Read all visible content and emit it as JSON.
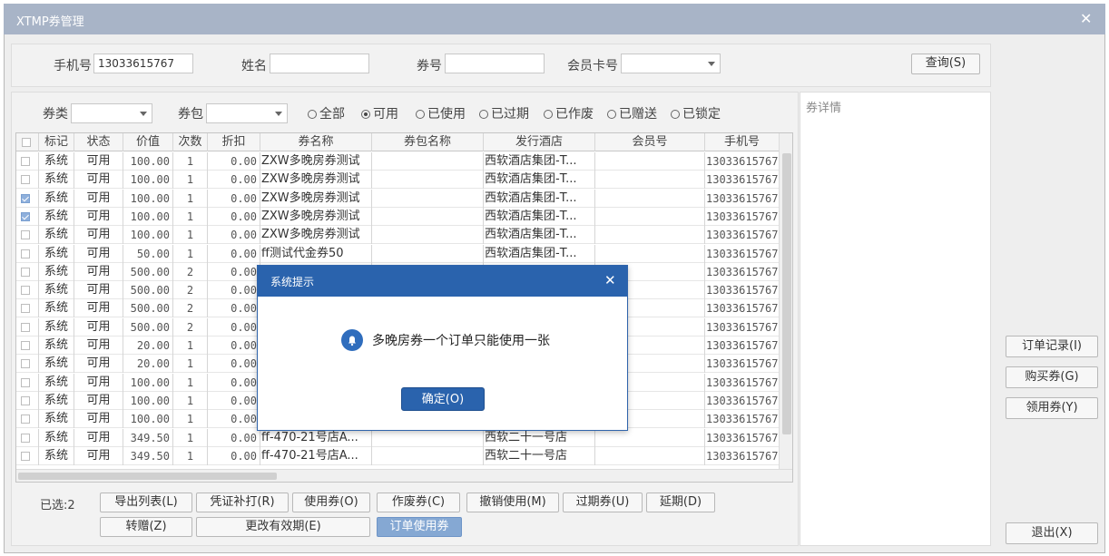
{
  "window": {
    "title": "XTMP券管理",
    "close": "✕"
  },
  "search": {
    "phone_label": "手机号",
    "phone_value": "13033615767",
    "name_label": "姓名",
    "name_value": "",
    "coupon_no_label": "券号",
    "coupon_no_value": "",
    "member_card_label": "会员卡号",
    "member_card_value": "",
    "query_button": "查询(S)"
  },
  "filters": {
    "type_label": "券类",
    "type_value": "",
    "package_label": "券包",
    "package_value": "",
    "status_options": [
      "全部",
      "可用",
      "已使用",
      "已过期",
      "已作废",
      "已赠送",
      "已锁定"
    ],
    "status_selected": "可用"
  },
  "grid": {
    "headers": [
      "",
      "标记",
      "状态",
      "价值",
      "次数",
      "折扣",
      "券名称",
      "券包名称",
      "发行酒店",
      "会员号",
      "手机号"
    ],
    "rows": [
      {
        "checked": false,
        "mark": "系统",
        "status": "可用",
        "value": "100.00",
        "count": "1",
        "discount": "0.00",
        "name": "ZXW多晚房券测试",
        "package": "",
        "hotel": "西软酒店集团-T...",
        "member": "",
        "phone": "13033615767"
      },
      {
        "checked": false,
        "mark": "系统",
        "status": "可用",
        "value": "100.00",
        "count": "1",
        "discount": "0.00",
        "name": "ZXW多晚房券测试",
        "package": "",
        "hotel": "西软酒店集团-T...",
        "member": "",
        "phone": "13033615767"
      },
      {
        "checked": true,
        "mark": "系统",
        "status": "可用",
        "value": "100.00",
        "count": "1",
        "discount": "0.00",
        "name": "ZXW多晚房券测试",
        "package": "",
        "hotel": "西软酒店集团-T...",
        "member": "",
        "phone": "13033615767"
      },
      {
        "checked": true,
        "mark": "系统",
        "status": "可用",
        "value": "100.00",
        "count": "1",
        "discount": "0.00",
        "name": "ZXW多晚房券测试",
        "package": "",
        "hotel": "西软酒店集团-T...",
        "member": "",
        "phone": "13033615767"
      },
      {
        "checked": false,
        "mark": "系统",
        "status": "可用",
        "value": "100.00",
        "count": "1",
        "discount": "0.00",
        "name": "ZXW多晚房券测试",
        "package": "",
        "hotel": "西软酒店集团-T...",
        "member": "",
        "phone": "13033615767"
      },
      {
        "checked": false,
        "mark": "系统",
        "status": "可用",
        "value": "50.00",
        "count": "1",
        "discount": "0.00",
        "name": "ff测试代金券50",
        "package": "",
        "hotel": "西软酒店集团-T...",
        "member": "",
        "phone": "13033615767"
      },
      {
        "checked": false,
        "mark": "系统",
        "status": "可用",
        "value": "500.00",
        "count": "2",
        "discount": "0.00",
        "name": "",
        "package": "",
        "hotel": "",
        "member": "",
        "phone": "13033615767"
      },
      {
        "checked": false,
        "mark": "系统",
        "status": "可用",
        "value": "500.00",
        "count": "2",
        "discount": "0.00",
        "name": "",
        "package": "",
        "hotel": "",
        "member": "",
        "phone": "13033615767"
      },
      {
        "checked": false,
        "mark": "系统",
        "status": "可用",
        "value": "500.00",
        "count": "2",
        "discount": "0.00",
        "name": "",
        "package": "",
        "hotel": "",
        "member": "",
        "phone": "13033615767"
      },
      {
        "checked": false,
        "mark": "系统",
        "status": "可用",
        "value": "500.00",
        "count": "2",
        "discount": "0.00",
        "name": "",
        "package": "",
        "hotel": "",
        "member": "",
        "phone": "13033615767"
      },
      {
        "checked": false,
        "mark": "系统",
        "status": "可用",
        "value": "20.00",
        "count": "1",
        "discount": "0.00",
        "name": "",
        "package": "",
        "hotel": "",
        "member": "",
        "phone": "13033615767"
      },
      {
        "checked": false,
        "mark": "系统",
        "status": "可用",
        "value": "20.00",
        "count": "1",
        "discount": "0.00",
        "name": "",
        "package": "",
        "hotel": "",
        "member": "",
        "phone": "13033615767"
      },
      {
        "checked": false,
        "mark": "系统",
        "status": "可用",
        "value": "100.00",
        "count": "1",
        "discount": "0.00",
        "name": "",
        "package": "",
        "hotel": "",
        "member": "",
        "phone": "13033615767"
      },
      {
        "checked": false,
        "mark": "系统",
        "status": "可用",
        "value": "100.00",
        "count": "1",
        "discount": "0.00",
        "name": "",
        "package": "",
        "hotel": "",
        "member": "",
        "phone": "13033615767"
      },
      {
        "checked": false,
        "mark": "系统",
        "status": "可用",
        "value": "100.00",
        "count": "1",
        "discount": "0.00",
        "name": "",
        "package": "",
        "hotel": "",
        "member": "",
        "phone": "13033615767"
      },
      {
        "checked": false,
        "mark": "系统",
        "status": "可用",
        "value": "349.50",
        "count": "1",
        "discount": "0.00",
        "name": "ff-470-21号店A...",
        "package": "",
        "hotel": "西软二十一号店",
        "member": "",
        "phone": "13033615767"
      },
      {
        "checked": false,
        "mark": "系统",
        "status": "可用",
        "value": "349.50",
        "count": "1",
        "discount": "0.00",
        "name": "ff-470-21号店A...",
        "package": "",
        "hotel": "西软二十一号店",
        "member": "",
        "phone": "13033615767"
      }
    ]
  },
  "detail": {
    "title": "券详情"
  },
  "side_buttons": {
    "order_record": "订单记录(I)",
    "buy_coupon": "购买券(G)",
    "use_coupon": "领用券(Y)",
    "exit": "退出(X)"
  },
  "bottom": {
    "selected_label": "已选:2",
    "row1": [
      "导出列表(L)",
      "凭证补打(R)",
      "使用券(O)",
      "作废券(C)",
      "撤销使用(M)",
      "过期券(U)",
      "延期(D)"
    ],
    "row2": [
      "转赠(Z)",
      "更改有效期(E)",
      "订单使用券"
    ]
  },
  "dialog": {
    "title": "系统提示",
    "close": "✕",
    "message": "多晚房券一个订单只能使用一张",
    "ok": "确定(O)"
  }
}
